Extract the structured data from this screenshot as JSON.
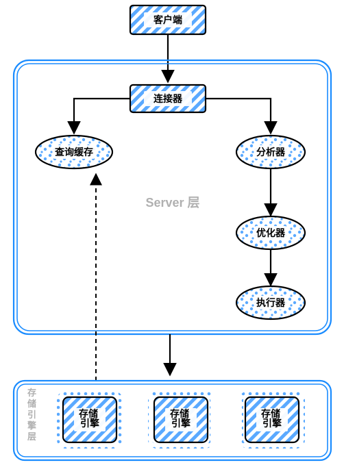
{
  "nodes": {
    "client": {
      "label": "客户端"
    },
    "connector": {
      "label": "连接器"
    },
    "cache": {
      "label": "查询缓存"
    },
    "analyzer": {
      "label": "分析器"
    },
    "optimizer": {
      "label": "优化器"
    },
    "executor": {
      "label": "执行器"
    },
    "storage1": {
      "label": "存储\n引擎"
    },
    "storage2": {
      "label": "存储\n引擎"
    },
    "storage3": {
      "label": "存储\n引擎"
    }
  },
  "layers": {
    "server": {
      "label": "Server 层"
    },
    "storage": {
      "label": "存\n储\n引\n擎\n层"
    }
  },
  "colors": {
    "blue": "#1a8cff",
    "black": "#000000",
    "gray": "#b0b0b0"
  }
}
